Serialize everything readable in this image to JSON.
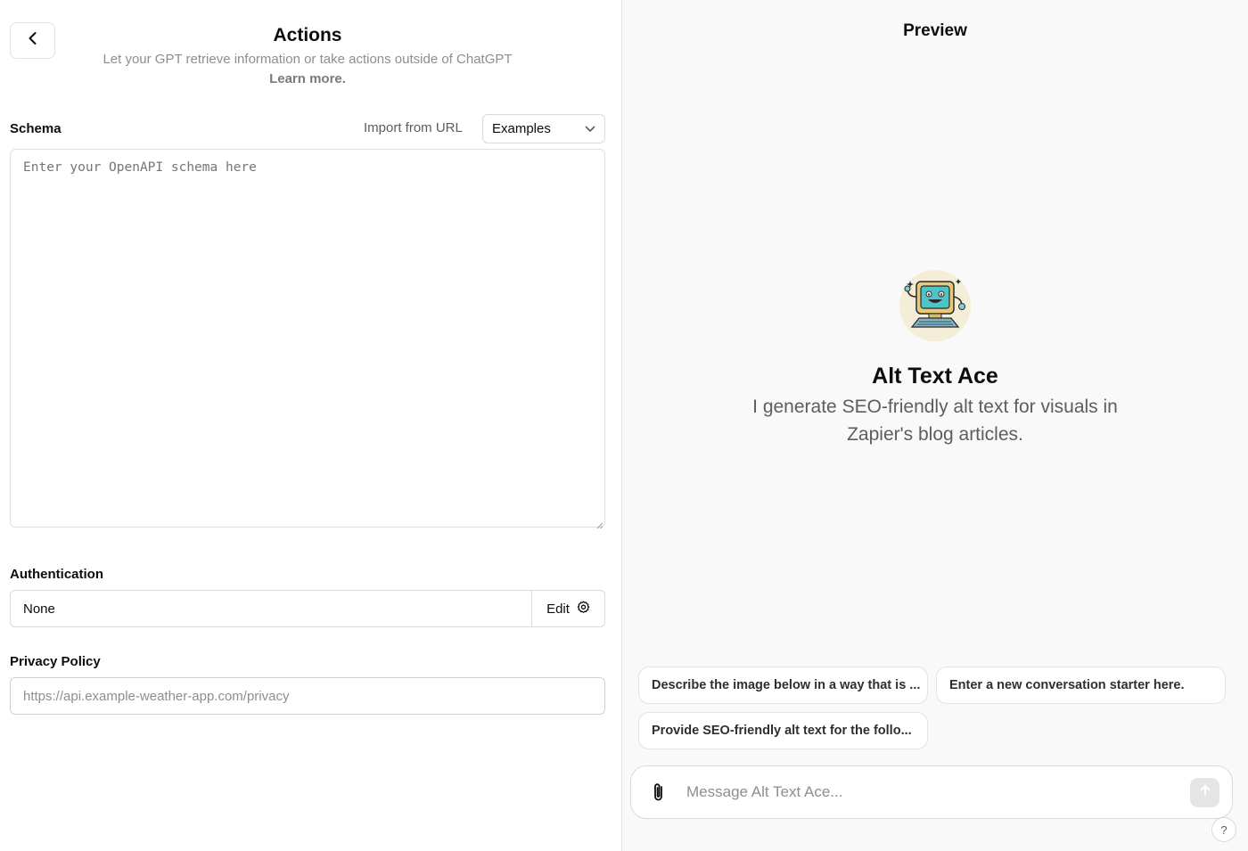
{
  "editor": {
    "header": {
      "title": "Actions",
      "subtitle": "Let your GPT retrieve information or take actions outside of ChatGPT",
      "learn_more": "Learn more."
    },
    "schema": {
      "label": "Schema",
      "import_label": "Import from URL",
      "examples_label": "Examples",
      "placeholder": "Enter your OpenAPI schema here",
      "value": ""
    },
    "authentication": {
      "label": "Authentication",
      "value": "None",
      "edit_label": "Edit"
    },
    "privacy": {
      "label": "Privacy Policy",
      "placeholder": "https://api.example-weather-app.com/privacy",
      "value": ""
    }
  },
  "preview": {
    "title": "Preview",
    "gpt_name": "Alt Text Ace",
    "gpt_description": "I generate SEO-friendly alt text for visuals in Zapier's blog articles.",
    "starters": [
      "Describe the image below in a way that is ...",
      "Enter a new conversation starter here.",
      "Provide SEO-friendly alt text for the follo..."
    ],
    "composer_placeholder": "Message Alt Text Ace...",
    "help_label": "?"
  },
  "icons": {
    "back": "chevron-left-icon",
    "dropdown": "chevron-down-icon",
    "settings": "gear-icon",
    "attach": "paperclip-icon",
    "send": "arrow-up-icon",
    "avatar": "retro-computer-mascot"
  },
  "colors": {
    "accent_text": "#0d0d0d",
    "muted_text": "#8e8e8e",
    "preview_bg": "#f9f9f9",
    "avatar_screen": "#4fc3c6"
  }
}
